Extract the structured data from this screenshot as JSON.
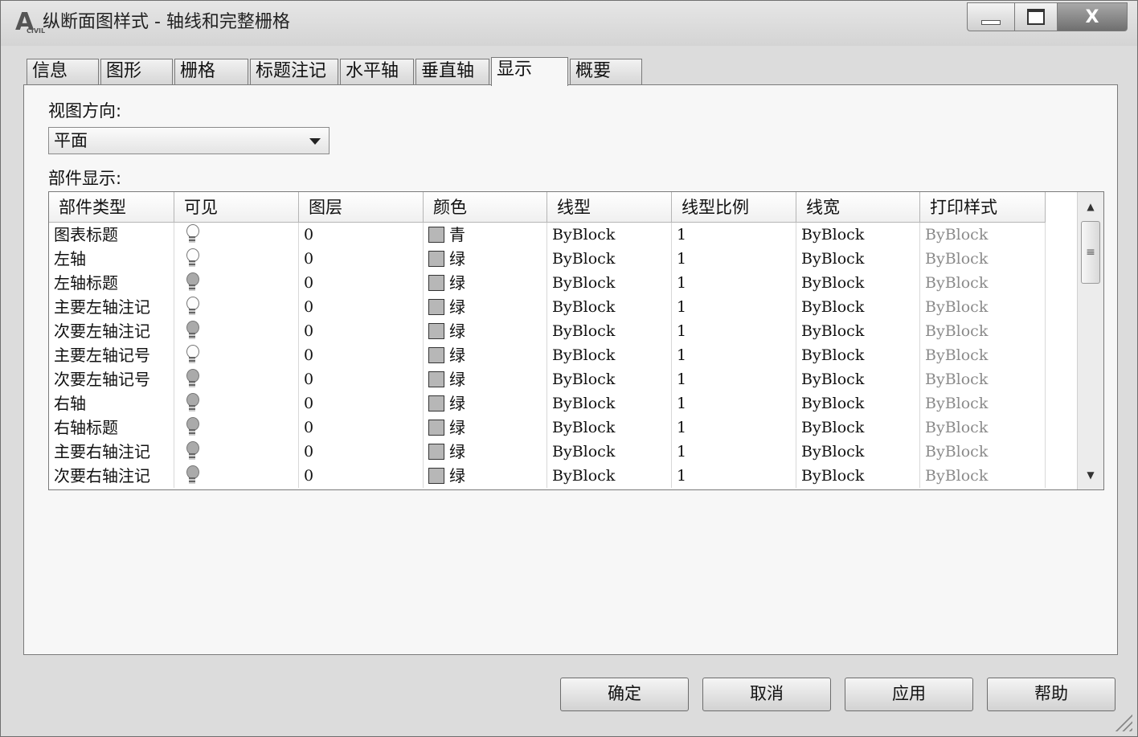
{
  "window": {
    "title": "纵断面图样式 - 轴线和完整栅格",
    "close_glyph": "X"
  },
  "tabs": [
    {
      "label": "信息"
    },
    {
      "label": "图形"
    },
    {
      "label": "栅格"
    },
    {
      "label": "标题注记"
    },
    {
      "label": "水平轴"
    },
    {
      "label": "垂直轴"
    },
    {
      "label": "显示"
    },
    {
      "label": "概要"
    }
  ],
  "active_tab": "显示",
  "view_direction": {
    "label": "视图方向:",
    "value": "平面"
  },
  "components": {
    "label": "部件显示:",
    "columns": [
      "部件类型",
      "可见",
      "图层",
      "颜色",
      "线型",
      "线型比例",
      "线宽",
      "打印样式"
    ],
    "rows": [
      {
        "type": "图表标题",
        "visible": true,
        "layer": "0",
        "color": "青",
        "linetype": "ByBlock",
        "scale": "1",
        "lineweight": "ByBlock",
        "plotstyle": "ByBlock"
      },
      {
        "type": "左轴",
        "visible": true,
        "layer": "0",
        "color": "绿",
        "linetype": "ByBlock",
        "scale": "1",
        "lineweight": "ByBlock",
        "plotstyle": "ByBlock"
      },
      {
        "type": "左轴标题",
        "visible": false,
        "layer": "0",
        "color": "绿",
        "linetype": "ByBlock",
        "scale": "1",
        "lineweight": "ByBlock",
        "plotstyle": "ByBlock"
      },
      {
        "type": "主要左轴注记",
        "visible": true,
        "layer": "0",
        "color": "绿",
        "linetype": "ByBlock",
        "scale": "1",
        "lineweight": "ByBlock",
        "plotstyle": "ByBlock"
      },
      {
        "type": "次要左轴注记",
        "visible": false,
        "layer": "0",
        "color": "绿",
        "linetype": "ByBlock",
        "scale": "1",
        "lineweight": "ByBlock",
        "plotstyle": "ByBlock"
      },
      {
        "type": "主要左轴记号",
        "visible": true,
        "layer": "0",
        "color": "绿",
        "linetype": "ByBlock",
        "scale": "1",
        "lineweight": "ByBlock",
        "plotstyle": "ByBlock"
      },
      {
        "type": "次要左轴记号",
        "visible": false,
        "layer": "0",
        "color": "绿",
        "linetype": "ByBlock",
        "scale": "1",
        "lineweight": "ByBlock",
        "plotstyle": "ByBlock"
      },
      {
        "type": "右轴",
        "visible": false,
        "layer": "0",
        "color": "绿",
        "linetype": "ByBlock",
        "scale": "1",
        "lineweight": "ByBlock",
        "plotstyle": "ByBlock"
      },
      {
        "type": "右轴标题",
        "visible": false,
        "layer": "0",
        "color": "绿",
        "linetype": "ByBlock",
        "scale": "1",
        "lineweight": "ByBlock",
        "plotstyle": "ByBlock"
      },
      {
        "type": "主要右轴注记",
        "visible": false,
        "layer": "0",
        "color": "绿",
        "linetype": "ByBlock",
        "scale": "1",
        "lineweight": "ByBlock",
        "plotstyle": "ByBlock"
      },
      {
        "type": "次要右轴注记",
        "visible": false,
        "layer": "0",
        "color": "绿",
        "linetype": "ByBlock",
        "scale": "1",
        "lineweight": "ByBlock",
        "plotstyle": "ByBlock"
      }
    ]
  },
  "buttons": {
    "ok": "确定",
    "cancel": "取消",
    "apply": "应用",
    "help": "帮助"
  },
  "icons": {
    "app": "autocad-logo-icon",
    "visible_on": "lightbulb-on-icon",
    "visible_off": "lightbulb-off-icon",
    "color_swatch": "color-swatch-icon",
    "dropdown": "chevron-down-icon"
  }
}
